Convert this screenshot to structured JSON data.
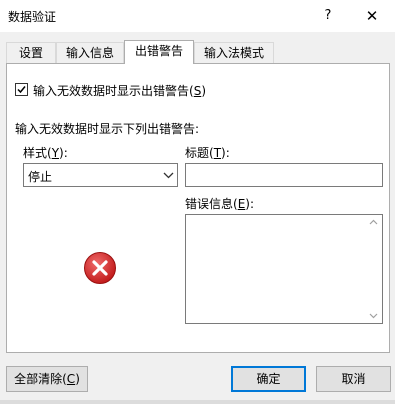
{
  "window": {
    "title": "数据验证",
    "help_glyph": "?",
    "close_glyph": "✕"
  },
  "tabs": [
    {
      "label": "设置"
    },
    {
      "label": "输入信息"
    },
    {
      "label": "出错警告",
      "active": true
    },
    {
      "label": "输入法模式"
    }
  ],
  "alert": {
    "show_checkbox": {
      "label_pre": "输入无效数据时显示出错警告(",
      "hotkey": "S",
      "label_post": ")",
      "checked": true
    },
    "section_label": "输入无效数据时显示下列出错警告:",
    "style": {
      "label_pre": "样式(",
      "hotkey": "Y",
      "label_post": "):",
      "value": "停止",
      "icon": "chevron-down-icon"
    },
    "title": {
      "label_pre": "标题(",
      "hotkey": "T",
      "label_post": "):",
      "value": ""
    },
    "error_message": {
      "label_pre": "错误信息(",
      "hotkey": "E",
      "label_post": "):",
      "value": ""
    },
    "icon": "stop-error-icon",
    "icon_color": "#d13438"
  },
  "footer": {
    "clear": {
      "label_pre": "全部清除(",
      "hotkey": "C",
      "label_post": ")"
    },
    "ok": "确定",
    "cancel": "取消"
  },
  "colors": {
    "accent": "#0078d7"
  }
}
